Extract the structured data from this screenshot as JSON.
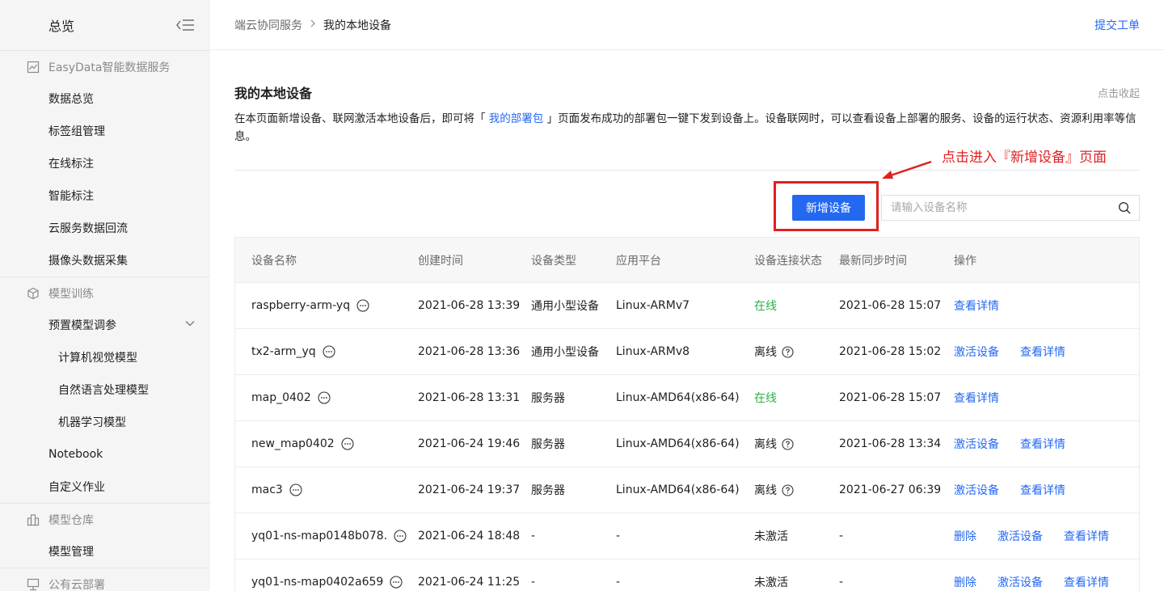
{
  "sidebar": {
    "title": "总览",
    "groups": [
      {
        "label": "EasyData智能数据服务",
        "items": [
          "数据总览",
          "标签组管理",
          "在线标注",
          "智能标注",
          "云服务数据回流",
          "摄像头数据采集"
        ]
      },
      {
        "label": "模型训练",
        "items": [
          "预置模型调参",
          "计算机视觉模型",
          "自然语言处理模型",
          "机器学习模型",
          "Notebook",
          "自定义作业"
        ]
      },
      {
        "label": "模型仓库",
        "items": [
          "模型管理"
        ]
      },
      {
        "label": "公有云部署",
        "items": []
      }
    ]
  },
  "header": {
    "breadcrumb": [
      "端云协同服务",
      "我的本地设备"
    ],
    "ticket_link": "提交工单"
  },
  "section": {
    "title": "我的本地设备",
    "collapse_link": "点击收起",
    "desc_before": "在本页面新增设备、联网激活本地设备后，即可将「 ",
    "desc_link": "我的部署包",
    "desc_after": " 」页面发布成功的部署包一键下发到设备上。设备联网时，可以查看设备上部署的服务、设备的运行状态、资源利用率等信息。"
  },
  "annotation": "点击进入『新增设备』页面",
  "toolbar": {
    "add_label": "新增设备",
    "search_placeholder": "请输入设备名称"
  },
  "table": {
    "headers": [
      "设备名称",
      "创建时间",
      "设备类型",
      "应用平台",
      "设备连接状态",
      "最新同步时间",
      "操作"
    ],
    "rows": [
      {
        "name": "raspberry-arm-yq",
        "created": "2021-06-28 13:39",
        "type": "通用小型设备",
        "platform": "Linux-ARMv7",
        "status": "在线",
        "synced": "2021-06-28 15:07",
        "ops": [
          "查看详情"
        ]
      },
      {
        "name": "tx2-arm_yq",
        "created": "2021-06-28 13:36",
        "type": "通用小型设备",
        "platform": "Linux-ARMv8",
        "status": "离线",
        "synced": "2021-06-28 15:02",
        "ops": [
          "激活设备",
          "查看详情"
        ]
      },
      {
        "name": "map_0402",
        "created": "2021-06-28 13:31",
        "type": "服务器",
        "platform": "Linux-AMD64(x86-64)",
        "status": "在线",
        "synced": "2021-06-28 15:07",
        "ops": [
          "查看详情"
        ]
      },
      {
        "name": "new_map0402",
        "created": "2021-06-24 19:46",
        "type": "服务器",
        "platform": "Linux-AMD64(x86-64)",
        "status": "离线",
        "synced": "2021-06-28 13:34",
        "ops": [
          "激活设备",
          "查看详情"
        ]
      },
      {
        "name": "mac3",
        "created": "2021-06-24 19:37",
        "type": "服务器",
        "platform": "Linux-AMD64(x86-64)",
        "status": "离线",
        "synced": "2021-06-27 06:39",
        "ops": [
          "激活设备",
          "查看详情"
        ]
      },
      {
        "name": "yq01-ns-map0148b078.",
        "created": "2021-06-24 18:48",
        "type": "-",
        "platform": "-",
        "status": "未激活",
        "synced": "-",
        "ops": [
          "删除",
          "激活设备",
          "查看详情"
        ]
      },
      {
        "name": "yq01-ns-map0402a659",
        "created": "2021-06-24 11:25",
        "type": "-",
        "platform": "-",
        "status": "未激活",
        "synced": "-",
        "ops": [
          "删除",
          "激活设备",
          "查看详情"
        ]
      }
    ]
  },
  "colors": {
    "accent": "#2468f2",
    "online": "#2bb045",
    "annotation": "#e02020"
  }
}
